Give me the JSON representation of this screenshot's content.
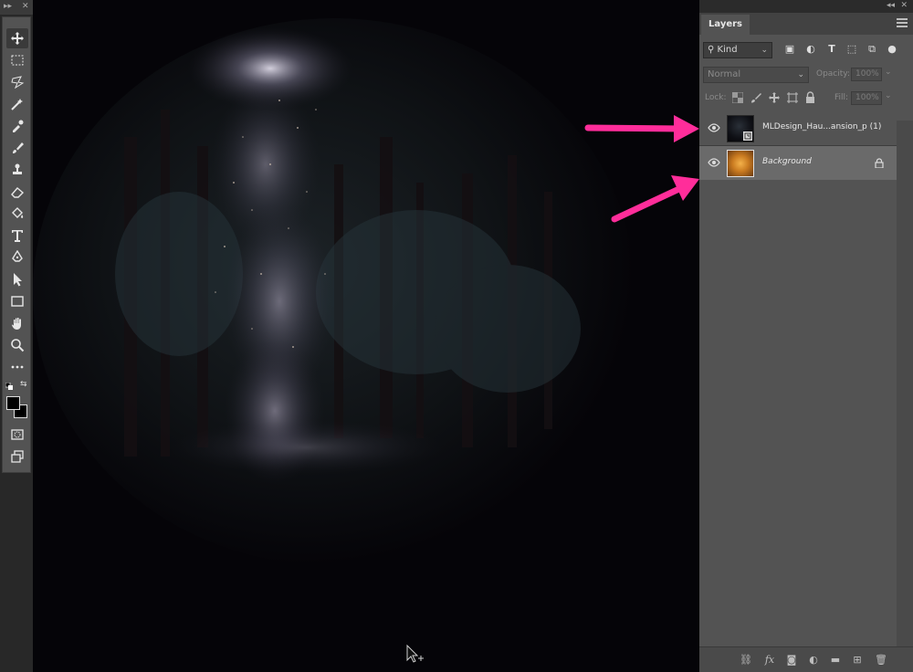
{
  "panel": {
    "tab_label": "Layers",
    "filter": {
      "kind_label": "Kind",
      "filter_icons": [
        "image-filter-icon",
        "adjustment-filter-icon",
        "type-filter-icon",
        "shape-filter-icon",
        "smart-object-filter-icon",
        "filter-toggle-icon"
      ]
    },
    "blend_mode": "Normal",
    "opacity_label": "Opacity:",
    "opacity_value": "100%",
    "lock_label": "Lock:",
    "fill_label": "Fill:",
    "fill_value": "100%",
    "layers": [
      {
        "name": "MLDesign_Hau...ansion_p (1)",
        "visible": true,
        "type": "smart-object"
      },
      {
        "name": "Background",
        "visible": true,
        "locked": true
      }
    ]
  },
  "annotations": {
    "arrow_color": "#ff2d9a"
  }
}
